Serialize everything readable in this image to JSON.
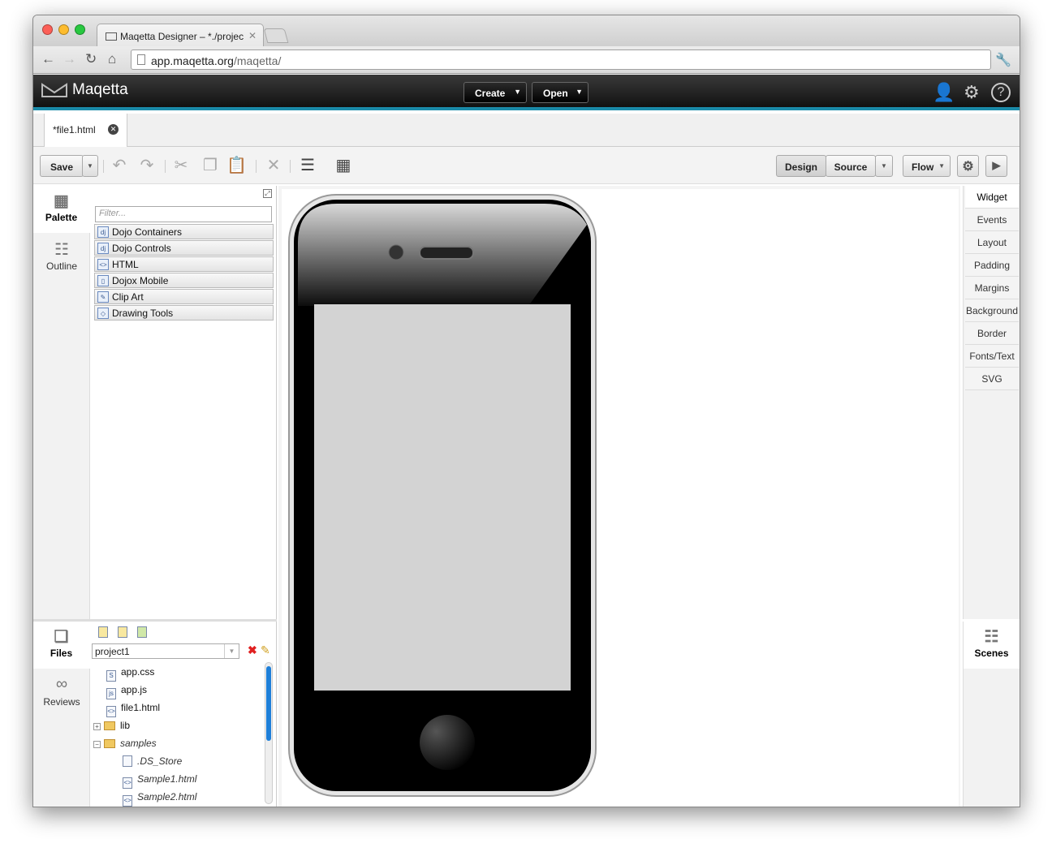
{
  "browser": {
    "tab_title": "Maqetta Designer – *./projec",
    "url_host": "app.maqetta.org",
    "url_path": "/maqetta/"
  },
  "app": {
    "logo_text": "Maqetta",
    "create_label": "Create",
    "open_label": "Open"
  },
  "editor_tab": {
    "label": "*file1.html"
  },
  "toolbar": {
    "save_label": "Save",
    "design_label": "Design",
    "source_label": "Source",
    "flow_label": "Flow"
  },
  "left_rail": {
    "palette_label": "Palette",
    "outline_label": "Outline",
    "files_label": "Files",
    "reviews_label": "Reviews"
  },
  "palette": {
    "filter_placeholder": "Filter...",
    "items": [
      {
        "label": "Dojo Containers",
        "icon": "dijit"
      },
      {
        "label": "Dojo Controls",
        "icon": "dijit"
      },
      {
        "label": "HTML",
        "icon": "html"
      },
      {
        "label": "Dojox Mobile",
        "icon": "mobile"
      },
      {
        "label": "Clip Art",
        "icon": "clipart"
      },
      {
        "label": "Drawing Tools",
        "icon": "draw"
      }
    ]
  },
  "files": {
    "project": "project1",
    "items": [
      {
        "label": "app.css",
        "icon": "S"
      },
      {
        "label": "app.js",
        "icon": "js"
      },
      {
        "label": "file1.html",
        "icon": "<>"
      },
      {
        "label": "lib"
      },
      {
        "label": "samples"
      },
      {
        "label": ".DS_Store"
      },
      {
        "label": "Sample1.html"
      },
      {
        "label": "Sample2.html"
      }
    ]
  },
  "right_rail": {
    "items": [
      "Widget",
      "Events",
      "Layout",
      "Padding",
      "Margins",
      "Background",
      "Border",
      "Fonts/Text",
      "SVG"
    ],
    "scenes_label": "Scenes"
  },
  "colors": {
    "accent": "#1a8aa8",
    "appbar": "#1a1a1a",
    "scroll_thumb": "#1e7fd9",
    "phone_screen": "#d3d3d3"
  }
}
